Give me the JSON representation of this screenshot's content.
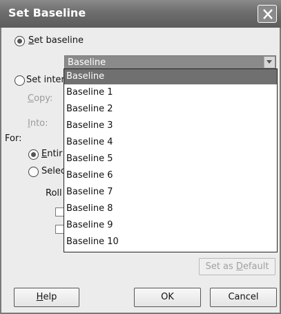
{
  "dialog": {
    "title": "Set Baseline",
    "close_icon": "close-x-icon"
  },
  "options": {
    "set_baseline_label_rest": "et baseline",
    "set_baseline_accel": "S",
    "set_interim_label": "Set inter",
    "copy_label": "opy:",
    "copy_accel": "C",
    "into_label": "nto:",
    "into_accel": "I"
  },
  "baseline_select": {
    "value": "Baseline",
    "items": [
      "Baseline",
      "Baseline 1",
      "Baseline 2",
      "Baseline 3",
      "Baseline 4",
      "Baseline 5",
      "Baseline 6",
      "Baseline 7",
      "Baseline 8",
      "Baseline 9",
      "Baseline 10"
    ],
    "selected_index": 0
  },
  "for_section": {
    "label": "For:",
    "entire_accel": "E",
    "entire_label": "ntir",
    "selected_label": "Selec",
    "roll_label": "Roll"
  },
  "buttons": {
    "set_default_prefix": "Set as ",
    "set_default_accel": "D",
    "set_default_suffix": "efault",
    "help_accel": "H",
    "help_rest": "elp",
    "ok": "OK",
    "cancel": "Cancel"
  },
  "colors": {
    "titlebar": "#6d6d6d",
    "selection": "#707070"
  }
}
